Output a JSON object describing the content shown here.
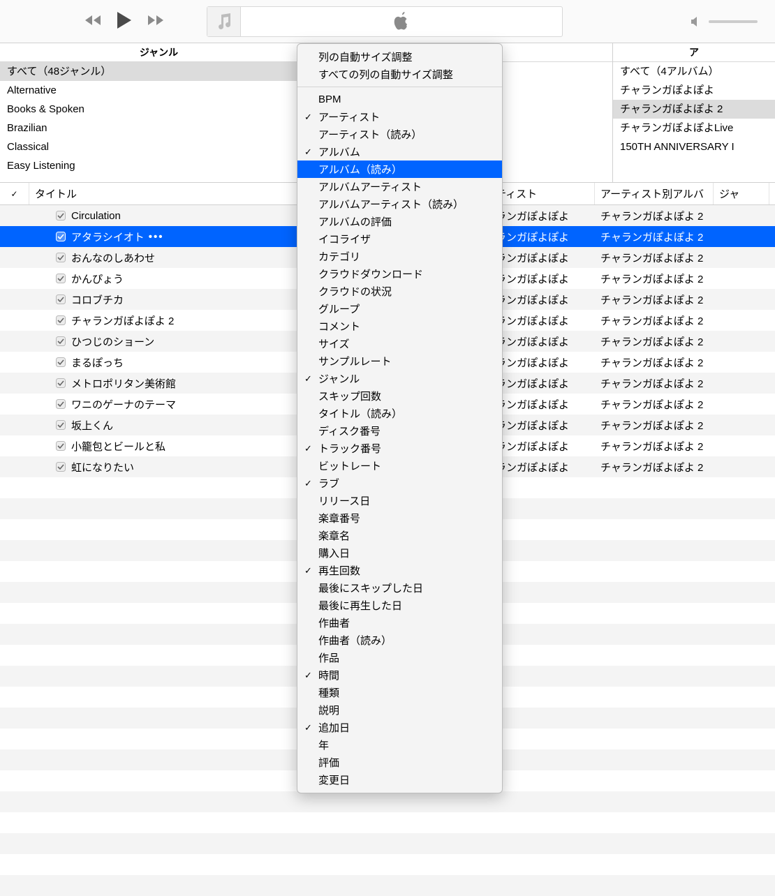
{
  "browser": {
    "genre": {
      "header": "ジャンル",
      "items": [
        {
          "label": "すべて（48ジャンル）",
          "selected": true
        },
        {
          "label": "Alternative"
        },
        {
          "label": "Books & Spoken"
        },
        {
          "label": "Brazilian"
        },
        {
          "label": "Classical"
        },
        {
          "label": "Easy Listening"
        }
      ]
    },
    "artist": {
      "header": "",
      "items": []
    },
    "album": {
      "header": "ア",
      "items": [
        {
          "label": "すべて（4アルバム）"
        },
        {
          "label": "チャランガぽよぽよ"
        },
        {
          "label": "チャランガぽよぽよ 2",
          "selected": true
        },
        {
          "label": "チャランガぽよぽよLive"
        },
        {
          "label": "150TH ANNIVERSARY I"
        }
      ]
    }
  },
  "track_headers": {
    "check": "✓",
    "title": "タイトル",
    "artist": "ティスト",
    "album": "アーティスト別アルバ",
    "genre": "ジャ"
  },
  "tracks": [
    {
      "title": "Circulation",
      "artist": "ランガぽよぽよ",
      "album": "チャランガぽよぽよ 2",
      "selected": false
    },
    {
      "title": "アタラシイオト",
      "artist": "ランガぽよぽよ",
      "album": "チャランガぽよぽよ 2",
      "selected": true,
      "show_menu": true
    },
    {
      "title": "おんなのしあわせ",
      "artist": "ランガぽよぽよ",
      "album": "チャランガぽよぽよ 2"
    },
    {
      "title": "かんぴょう",
      "artist": "ランガぽよぽよ",
      "album": "チャランガぽよぽよ 2"
    },
    {
      "title": "コロブチカ",
      "artist": "ランガぽよぽよ",
      "album": "チャランガぽよぽよ 2"
    },
    {
      "title": "チャランガぽよぽよ 2",
      "artist": "ランガぽよぽよ",
      "album": "チャランガぽよぽよ 2"
    },
    {
      "title": "ひつじのショーン",
      "artist": "ランガぽよぽよ",
      "album": "チャランガぽよぽよ 2"
    },
    {
      "title": "まるぽっち",
      "artist": "ランガぽよぽよ",
      "album": "チャランガぽよぽよ 2"
    },
    {
      "title": "メトロポリタン美術館",
      "artist": "ランガぽよぽよ",
      "album": "チャランガぽよぽよ 2"
    },
    {
      "title": "ワニのゲーナのテーマ",
      "artist": "ランガぽよぽよ",
      "album": "チャランガぽよぽよ 2"
    },
    {
      "title": "坂上くん",
      "artist": "ランガぽよぽよ",
      "album": "チャランガぽよぽよ 2"
    },
    {
      "title": "小籠包とビールと私",
      "artist": "ランガぽよぽよ",
      "album": "チャランガぽよぽよ 2"
    },
    {
      "title": "虹になりたい",
      "artist": "ランガぽよぽよ",
      "album": "チャランガぽよぽよ 2"
    }
  ],
  "context_menu": {
    "top_items": [
      {
        "label": "列の自動サイズ調整"
      },
      {
        "label": "すべての列の自動サイズ調整"
      }
    ],
    "column_items": [
      {
        "label": "BPM"
      },
      {
        "label": "アーティスト",
        "checked": true
      },
      {
        "label": "アーティスト（読み）"
      },
      {
        "label": "アルバム",
        "checked": true
      },
      {
        "label": "アルバム（読み）",
        "highlighted": true
      },
      {
        "label": "アルバムアーティスト"
      },
      {
        "label": "アルバムアーティスト（読み）"
      },
      {
        "label": "アルバムの評価"
      },
      {
        "label": "イコライザ"
      },
      {
        "label": "カテゴリ"
      },
      {
        "label": "クラウドダウンロード"
      },
      {
        "label": "クラウドの状況"
      },
      {
        "label": "グループ"
      },
      {
        "label": "コメント"
      },
      {
        "label": "サイズ"
      },
      {
        "label": "サンプルレート"
      },
      {
        "label": "ジャンル",
        "checked": true
      },
      {
        "label": "スキップ回数"
      },
      {
        "label": "タイトル（読み）"
      },
      {
        "label": "ディスク番号"
      },
      {
        "label": "トラック番号",
        "checked": true
      },
      {
        "label": "ビットレート"
      },
      {
        "label": "ラブ",
        "checked": true
      },
      {
        "label": "リリース日"
      },
      {
        "label": "楽章番号"
      },
      {
        "label": "楽章名"
      },
      {
        "label": "購入日"
      },
      {
        "label": "再生回数",
        "checked": true
      },
      {
        "label": "最後にスキップした日"
      },
      {
        "label": "最後に再生した日"
      },
      {
        "label": "作曲者"
      },
      {
        "label": "作曲者（読み）"
      },
      {
        "label": "作品"
      },
      {
        "label": "時間",
        "checked": true
      },
      {
        "label": "種類"
      },
      {
        "label": "説明"
      },
      {
        "label": "追加日",
        "checked": true
      },
      {
        "label": "年"
      },
      {
        "label": "評価"
      },
      {
        "label": "変更日"
      }
    ]
  }
}
